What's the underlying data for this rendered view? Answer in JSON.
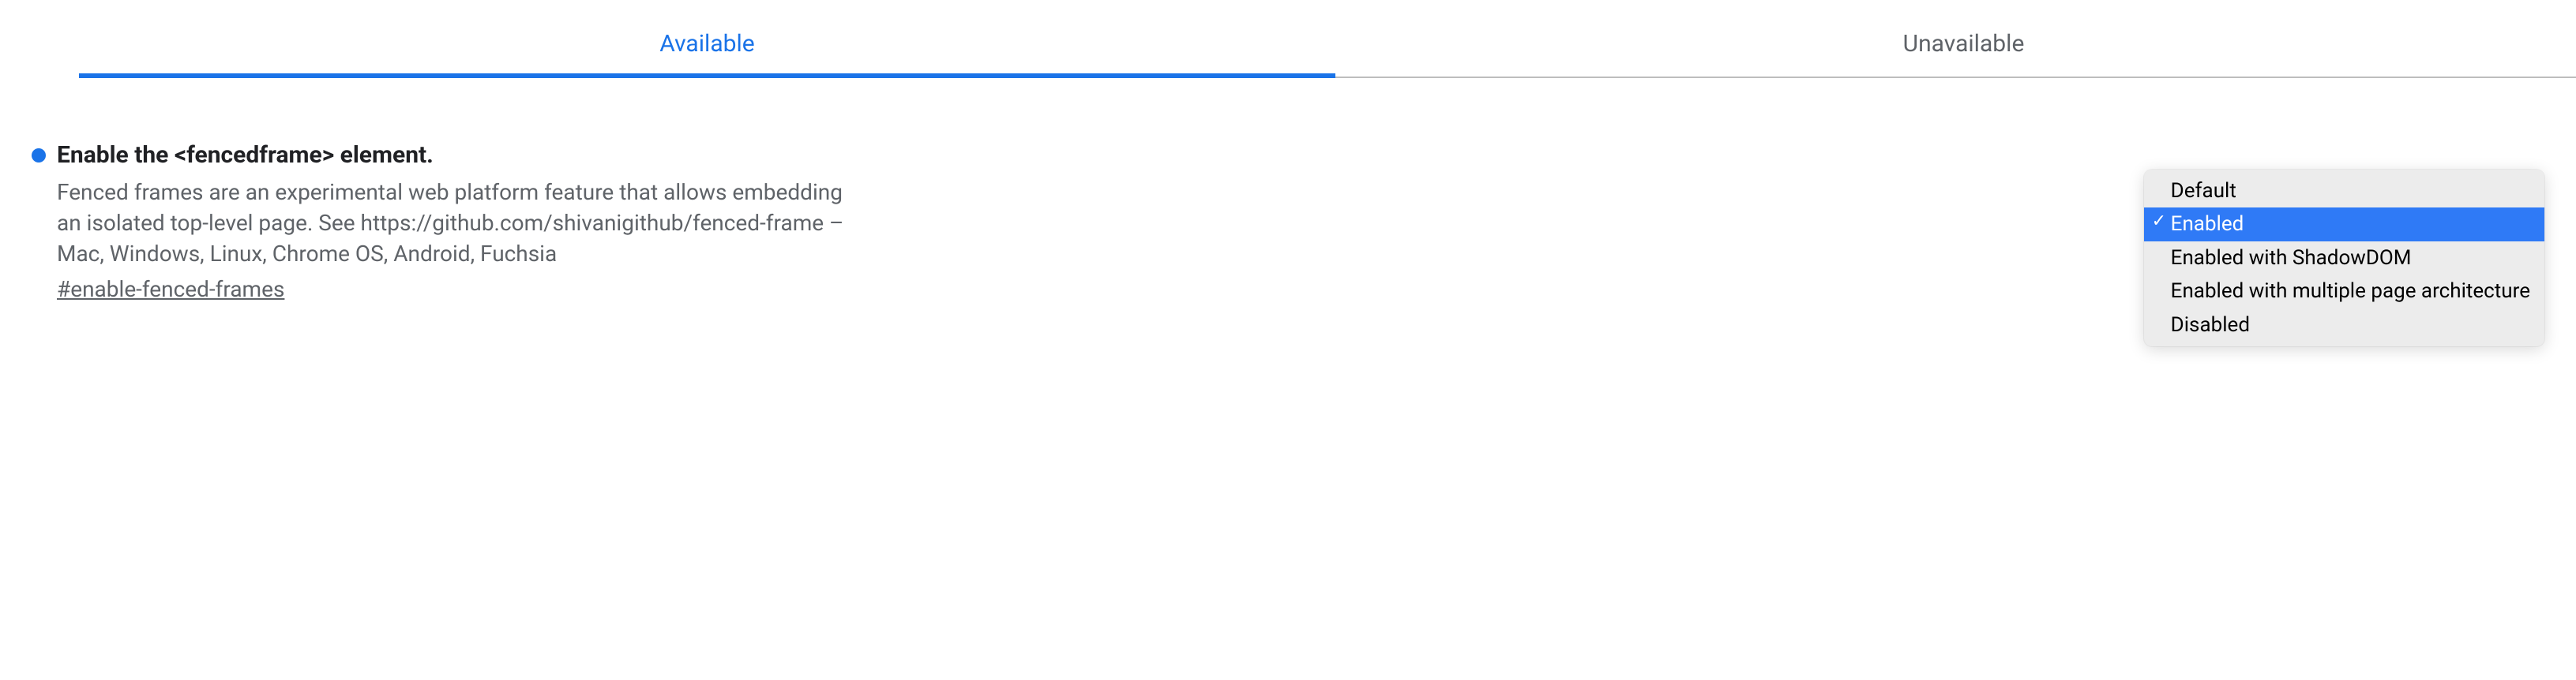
{
  "tabs": {
    "available": "Available",
    "unavailable": "Unavailable"
  },
  "flag": {
    "title": "Enable the <fencedframe> element.",
    "description": "Fenced frames are an experimental web platform feature that allows embedding an isolated top-level page. See https://github.com/shivanigithub/fenced-frame – Mac, Windows, Linux, Chrome OS, Android, Fuchsia",
    "anchor": "#enable-fenced-frames"
  },
  "dropdown": {
    "options": {
      "0": "Default",
      "1": "Enabled",
      "2": "Enabled with ShadowDOM",
      "3": "Enabled with multiple page architecture",
      "4": "Disabled"
    },
    "selected_index": 1
  }
}
